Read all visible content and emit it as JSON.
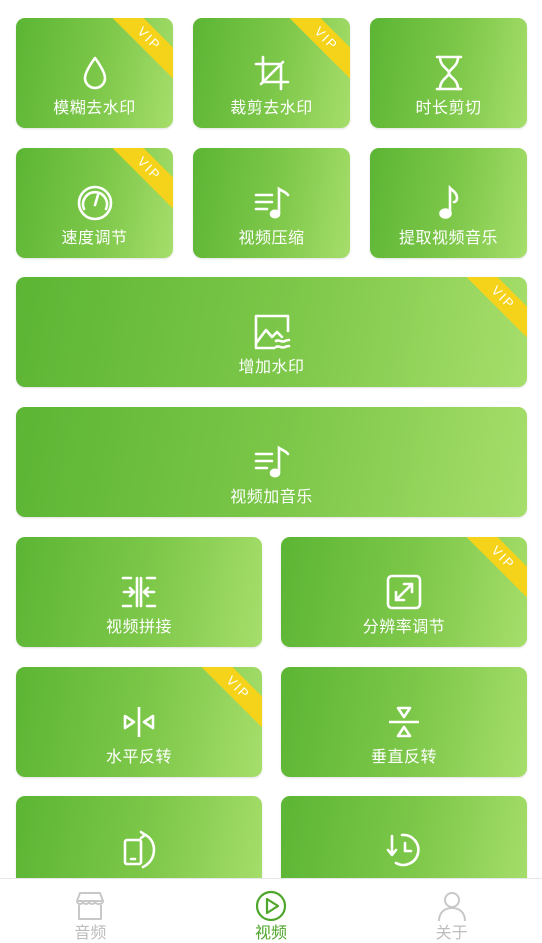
{
  "colors": {
    "accent": "#4ea62a",
    "vip": "#f5d31a",
    "tile_start": "#5cb534",
    "tile_end": "#a6de6b"
  },
  "vip_text": "VIP",
  "tiles": {
    "blur_watermark": {
      "label": "模糊去水印",
      "icon": "water-drop-icon",
      "vip": true
    },
    "crop_watermark": {
      "label": "裁剪去水印",
      "icon": "crop-icon",
      "vip": true
    },
    "duration_cut": {
      "label": "时长剪切",
      "icon": "hourglass-icon",
      "vip": false
    },
    "speed_adjust": {
      "label": "速度调节",
      "icon": "speedometer-icon",
      "vip": true
    },
    "video_compress": {
      "label": "视频压缩",
      "icon": "music-list-icon",
      "vip": false
    },
    "extract_audio": {
      "label": "提取视频音乐",
      "icon": "music-note-icon",
      "vip": false
    },
    "add_watermark": {
      "label": "增加水印",
      "icon": "image-icon",
      "vip": true
    },
    "add_music": {
      "label": "视频加音乐",
      "icon": "music-list-icon",
      "vip": false
    },
    "video_merge": {
      "label": "视频拼接",
      "icon": "merge-icon",
      "vip": false
    },
    "resolution": {
      "label": "分辨率调节",
      "icon": "expand-icon",
      "vip": true
    },
    "flip_horizontal": {
      "label": "水平反转",
      "icon": "flip-horizontal-icon",
      "vip": true
    },
    "flip_vertical": {
      "label": "垂直反转",
      "icon": "flip-vertical-icon",
      "vip": false
    },
    "rotate": {
      "label": "",
      "icon": "phone-rotate-icon",
      "vip": false
    },
    "reverse": {
      "label": "",
      "icon": "reverse-clock-icon",
      "vip": false
    }
  },
  "tabbar": {
    "audio": {
      "label": "音频",
      "icon": "store-icon",
      "active": false
    },
    "video": {
      "label": "视频",
      "icon": "play-circle-icon",
      "active": true
    },
    "about": {
      "label": "关于",
      "icon": "person-icon",
      "active": false
    }
  }
}
